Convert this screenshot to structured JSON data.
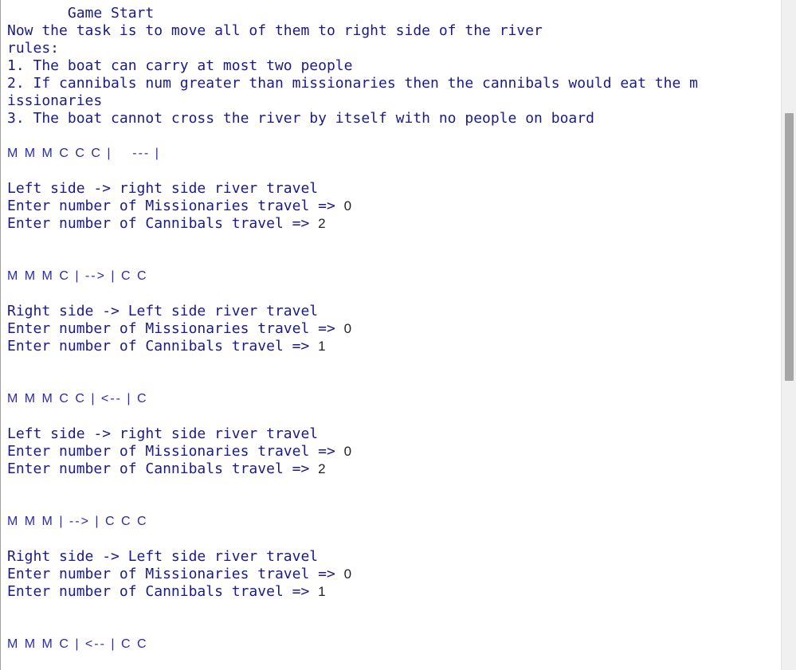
{
  "console": {
    "lines": [
      {
        "text": "       Game Start",
        "kind": "out"
      },
      {
        "text": "Now the task is to move all of them to right side of the river",
        "kind": "out"
      },
      {
        "text": "rules:",
        "kind": "out"
      },
      {
        "text": "1. The boat can carry at most two people",
        "kind": "out"
      },
      {
        "text": "2. If cannibals num greater than missionaries then the cannibals would eat the m",
        "kind": "out"
      },
      {
        "text": "issionaries",
        "kind": "out"
      },
      {
        "text": "3. The boat cannot cross the river by itself with no people on board",
        "kind": "out"
      },
      {
        "text": "M M M C C C |    --- |",
        "kind": "state"
      },
      {
        "text": "Left side -> right side river travel",
        "kind": "out"
      },
      {
        "text": "Enter number of Missionaries travel => ",
        "kind": "out",
        "input": "0"
      },
      {
        "text": "Enter number of Cannibals travel => ",
        "kind": "out",
        "input": "2"
      },
      {
        "text": "M M M C | --> | C C",
        "kind": "state"
      },
      {
        "text": "Right side -> Left side river travel",
        "kind": "out"
      },
      {
        "text": "Enter number of Missionaries travel => ",
        "kind": "out",
        "input": "0"
      },
      {
        "text": "Enter number of Cannibals travel => ",
        "kind": "out",
        "input": "1"
      },
      {
        "text": "M M M C C | <-- | C",
        "kind": "state"
      },
      {
        "text": "Left side -> right side river travel",
        "kind": "out"
      },
      {
        "text": "Enter number of Missionaries travel => ",
        "kind": "out",
        "input": "0"
      },
      {
        "text": "Enter number of Cannibals travel => ",
        "kind": "out",
        "input": "2"
      },
      {
        "text": "M M M | --> | C C C",
        "kind": "state"
      },
      {
        "text": "Right side -> Left side river travel",
        "kind": "out"
      },
      {
        "text": "Enter number of Missionaries travel => ",
        "kind": "out",
        "input": "0"
      },
      {
        "text": "Enter number of Cannibals travel => ",
        "kind": "out",
        "input": "1"
      },
      {
        "text": "M M M C | <-- | C C",
        "kind": "state"
      }
    ]
  }
}
